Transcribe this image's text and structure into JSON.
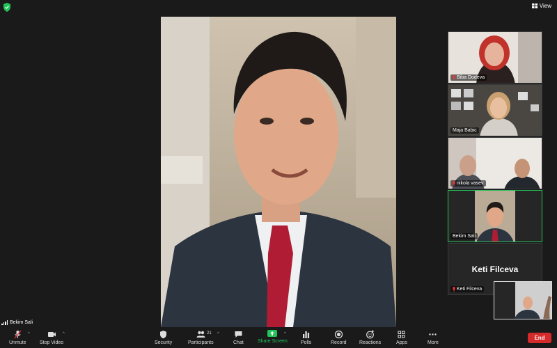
{
  "topbar": {
    "view_label": "View"
  },
  "main_speaker": {
    "name": "Bekim Sali"
  },
  "participants": [
    {
      "name": "Biba Dodeva",
      "muted": true
    },
    {
      "name": "Maja Babic",
      "muted": false
    },
    {
      "name": "nikola vasev",
      "muted": true
    },
    {
      "name": "Bekim Sali",
      "muted": false,
      "active": true
    },
    {
      "name": "Keti Filceva",
      "muted": true,
      "display_text": "Keti Filceva"
    }
  ],
  "toolbar": {
    "unmute": "Unmute",
    "stop_video": "Stop Video",
    "security": "Security",
    "participants": "Participants",
    "participants_count": "21",
    "chat": "Chat",
    "share_screen": "Share Screen",
    "polls": "Polls",
    "record": "Record",
    "reactions": "Reactions",
    "apps": "Apps",
    "more": "More",
    "end": "End"
  },
  "colors": {
    "accent_green": "#23c35a",
    "end_red": "#d72a2a",
    "background": "#1a1a1a"
  }
}
